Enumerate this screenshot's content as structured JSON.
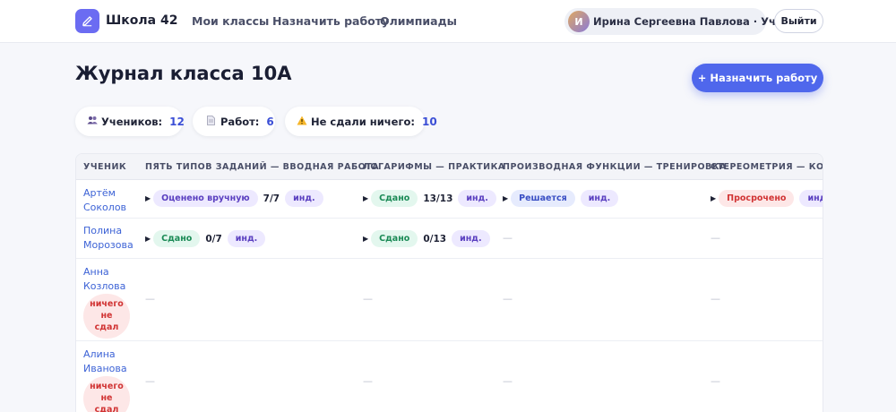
{
  "brand": {
    "name": "Школа 42",
    "logo_icon": "pencil-icon"
  },
  "nav": [
    {
      "label": "Мои классы"
    },
    {
      "label": "Назначить работу"
    },
    {
      "label": "Олимпиады"
    }
  ],
  "user": {
    "initial": "И",
    "label": "Ирина Сергеевна Павлова · Учитель"
  },
  "logout_label": "Выйти",
  "page": {
    "title": "Журнал класса 10А",
    "assign_button": "+ Назначить работу"
  },
  "stats": [
    {
      "icon": "people-icon",
      "label": "Учеников:",
      "value": "12"
    },
    {
      "icon": "document-icon",
      "label": "Работ:",
      "value": "6"
    },
    {
      "icon": "warning-icon",
      "label": "Не сдали ничего:",
      "value": "10"
    }
  ],
  "table": {
    "columns": [
      "УЧЕНИК",
      "ПЯТЬ ТИПОВ ЗАДАНИЙ — ВВОДНАЯ РАБОТА",
      "ЛОГАРИФМЫ — ПРАКТИКА",
      "ПРОИЗВОДНАЯ ФУНКЦИИ — ТРЕНИРОВКА",
      "СТЕРЕОМЕТРИЯ — КОНТР"
    ],
    "dash": "—",
    "ind_label": "инд.",
    "none_label": [
      "ничего",
      "не",
      "сдал"
    ],
    "rows": [
      {
        "name": [
          "Артём",
          "Соколов"
        ],
        "cells": [
          {
            "status": "Оценено вручную",
            "kind": "manual",
            "score": "7/7"
          },
          {
            "status": "Сдано",
            "kind": "done",
            "score": "13/13"
          },
          {
            "status": "Решается",
            "kind": "solving",
            "score": ""
          },
          {
            "status": "Просрочено",
            "kind": "late",
            "score": ""
          }
        ]
      },
      {
        "name": [
          "Полина",
          "Морозова"
        ],
        "cells": [
          {
            "status": "Сдано",
            "kind": "done",
            "score": "0/7"
          },
          {
            "status": "Сдано",
            "kind": "done",
            "score": "0/13"
          }
        ]
      },
      {
        "name": [
          "Анна",
          "Козлова"
        ],
        "nothing": true
      },
      {
        "name": [
          "Алина",
          "Иванова"
        ],
        "nothing": true
      }
    ]
  }
}
